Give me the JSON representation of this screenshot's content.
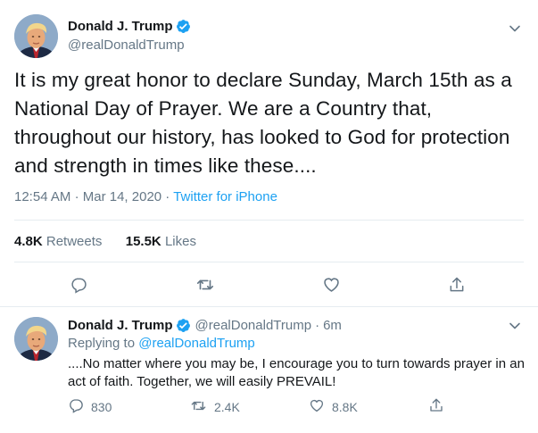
{
  "main_tweet": {
    "display_name": "Donald J. Trump",
    "handle": "@realDonaldTrump",
    "text": "It is my great honor to declare Sunday, March 15th as a National Day of Prayer. We are a Country that, throughout our history, has looked to God for protection and strength in times like these....",
    "time": "12:54 AM",
    "date": "Mar 14, 2020",
    "source": "Twitter for iPhone",
    "retweets_count": "4.8K",
    "retweets_label": "Retweets",
    "likes_count": "15.5K",
    "likes_label": "Likes"
  },
  "reply_tweet": {
    "display_name": "Donald J. Trump",
    "handle": "@realDonaldTrump",
    "age": "6m",
    "replying_prefix": "Replying to",
    "replying_to": "@realDonaldTrump",
    "text": "....No matter where you may be, I encourage you to turn towards prayer in an act of faith. Together, we will easily PREVAIL!",
    "reply_count": "830",
    "retweet_count": "2.4K",
    "like_count": "8.8K"
  },
  "separators": {
    "dot": "·"
  },
  "icons": {
    "verified": "verified-badge-icon",
    "caret": "chevron-down-icon",
    "reply": "reply-icon",
    "retweet": "retweet-icon",
    "like": "heart-icon",
    "share": "share-icon"
  },
  "colors": {
    "accent": "#1da1f2",
    "secondary_text": "#657786",
    "primary_text": "#14171a",
    "divider": "#e6ecf0"
  }
}
